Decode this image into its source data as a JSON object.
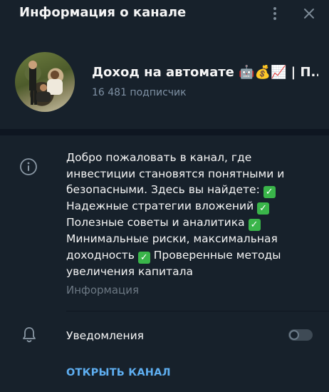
{
  "header": {
    "title": "Информация о канале"
  },
  "channel": {
    "name": "Доход на автомате 🤖💰📈 | П...",
    "subscribers": "16 481 подписчик"
  },
  "description": {
    "lines": [
      "Добро пожаловать в канал, где",
      "инвестиции становятся понятными и",
      "безопасными. Здесь вы найдете:",
      "Надежные стратегии вложений",
      "Полезные советы и аналитика",
      "Минимальные риски, максимальная",
      "доходность",
      "Проверенные методы",
      "увеличения капитала"
    ],
    "check_glyph": "✓",
    "label": "Информация"
  },
  "notifications": {
    "label": "Уведомления",
    "enabled": false
  },
  "actions": {
    "open_channel": "ОТКРЫТЬ КАНАЛ"
  },
  "colors": {
    "background": "#17212b",
    "accent": "#5eaef0",
    "muted": "#7f91a4",
    "check_green": "#3ab54a"
  }
}
